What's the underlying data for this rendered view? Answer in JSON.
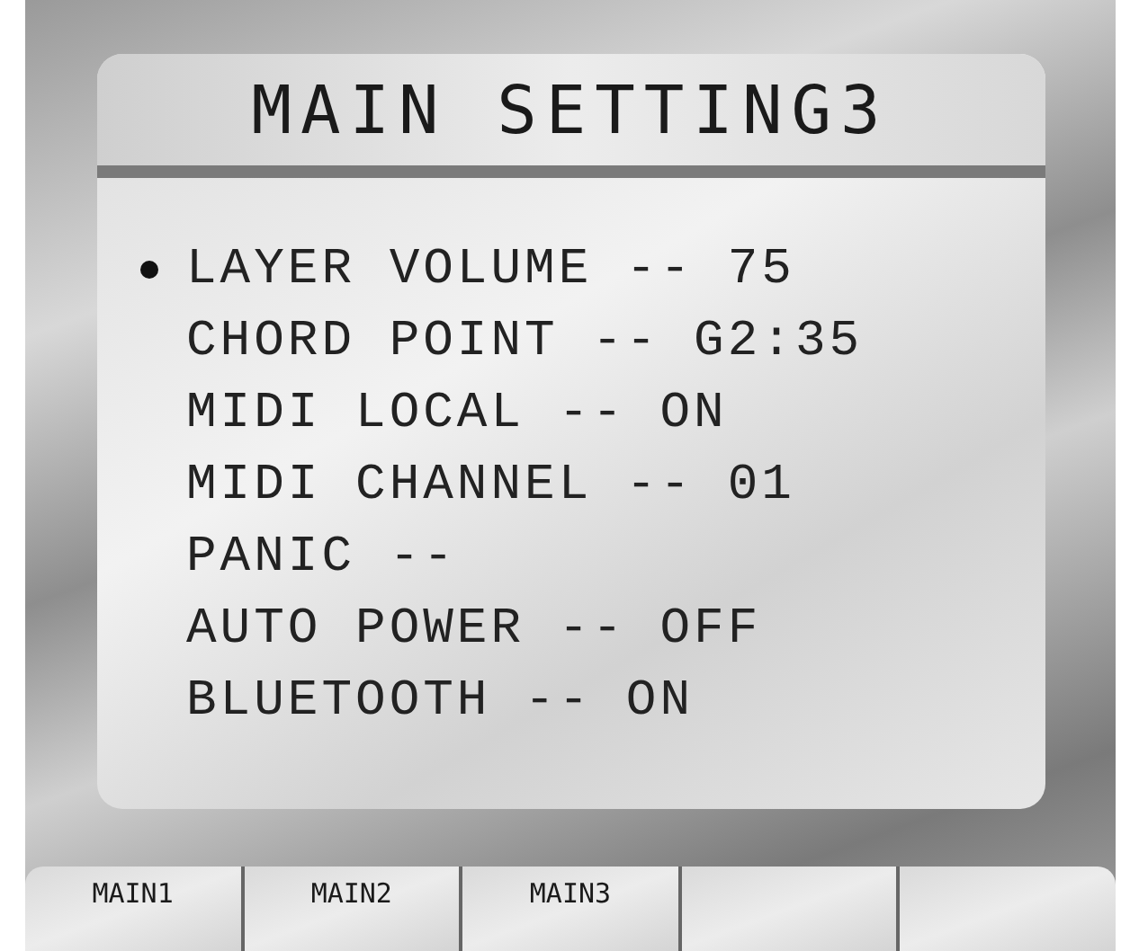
{
  "screen": {
    "title": "MAIN SETTING3"
  },
  "menu_items": [
    {
      "label": "LAYER VOLUME -- 75",
      "selected": true
    },
    {
      "label": "CHORD POINT -- G2:35",
      "selected": false
    },
    {
      "label": "MIDI LOCAL -- ON",
      "selected": false
    },
    {
      "label": "MIDI CHANNEL -- 01",
      "selected": false
    },
    {
      "label": "PANIC --",
      "selected": false
    },
    {
      "label": "AUTO POWER -- OFF",
      "selected": false
    },
    {
      "label": "BLUETOOTH -- ON",
      "selected": false
    }
  ],
  "soft_keys": [
    {
      "label": "MAIN1"
    },
    {
      "label": "MAIN2"
    },
    {
      "label": "MAIN3"
    }
  ]
}
